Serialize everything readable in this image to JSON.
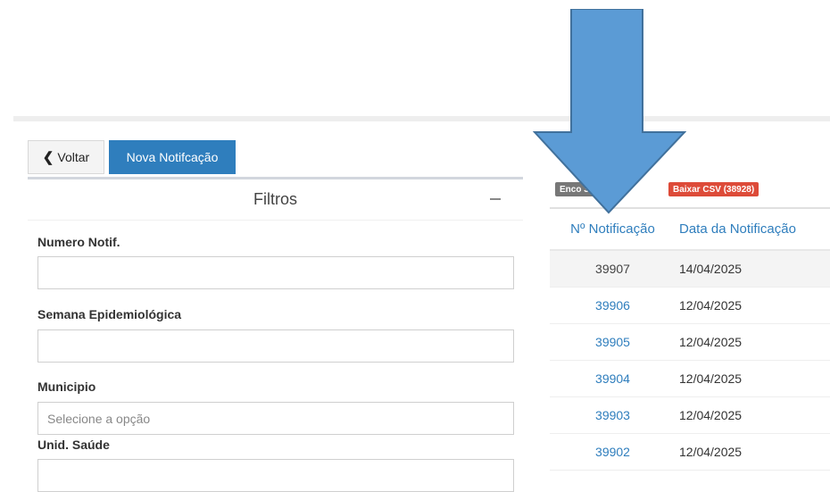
{
  "toolbar": {
    "back_label": "Voltar",
    "new_label": "Nova Notifcação"
  },
  "filters": {
    "title": "Filtros",
    "fields": [
      {
        "label": "Numero Notif.",
        "value": "",
        "placeholder": ""
      },
      {
        "label": "Semana Epidemiológica",
        "value": "",
        "placeholder": ""
      },
      {
        "label": "Municipio",
        "value": "",
        "placeholder": "Selecione a opção"
      },
      {
        "label": "Unid. Saúde",
        "value": "",
        "placeholder": ""
      }
    ]
  },
  "results": {
    "found_badge": "Enco      39 mil",
    "csv_badge": "Baixar CSV (38928)"
  },
  "table": {
    "headers": [
      "Nº Notificação",
      "Data da Notificação"
    ],
    "rows": [
      {
        "num": "39907",
        "date": "14/04/2025"
      },
      {
        "num": "39906",
        "date": "12/04/2025"
      },
      {
        "num": "39905",
        "date": "12/04/2025"
      },
      {
        "num": "39904",
        "date": "12/04/2025"
      },
      {
        "num": "39903",
        "date": "12/04/2025"
      },
      {
        "num": "39902",
        "date": "12/04/2025"
      }
    ]
  },
  "colors": {
    "primary": "#2f7ebd",
    "danger": "#dd4b39",
    "badge_gray": "#777777",
    "arrow_fill": "#5b9bd5",
    "arrow_stroke": "#41719c"
  },
  "icons": {
    "back": "chevron-left-icon",
    "collapse": "minus-icon",
    "annotation": "down-arrow-icon"
  }
}
